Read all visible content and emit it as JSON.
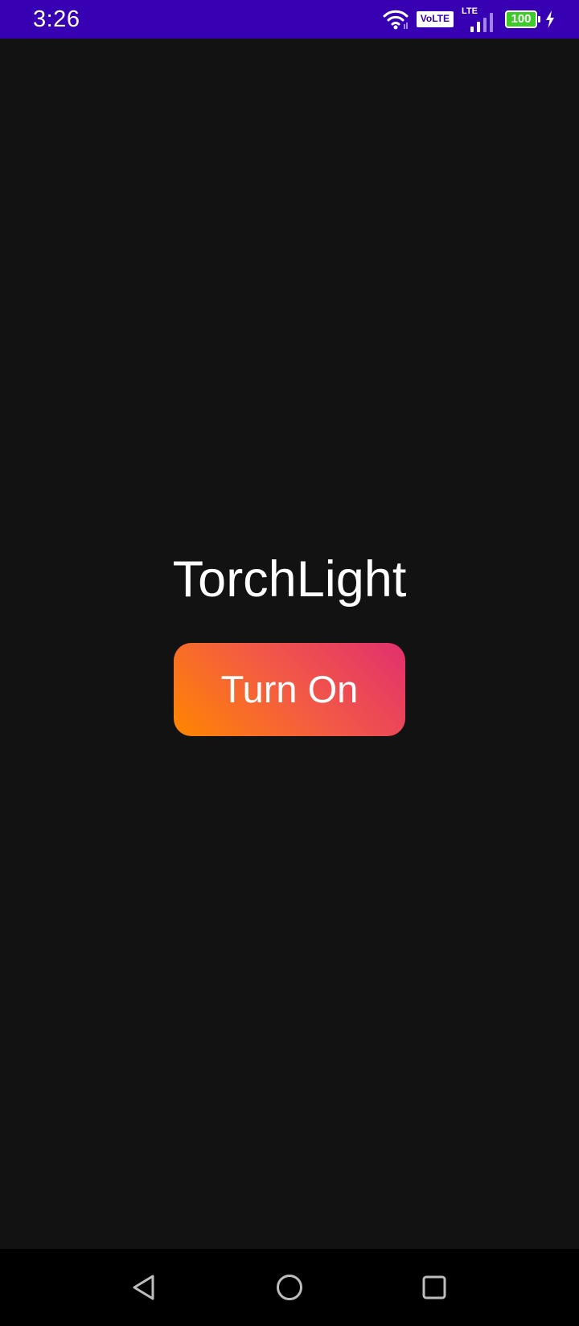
{
  "status_bar": {
    "time": "3:26",
    "volte": "VoLTE",
    "network": "LTE",
    "battery": "100",
    "icons": [
      "wifi-icon",
      "signal-icon",
      "battery-icon",
      "charging-bolt-icon"
    ],
    "background_color": "#3700b3"
  },
  "main": {
    "title": "TorchLight",
    "toggle_button_label": "Turn On",
    "background_color": "#121212",
    "button_gradient": [
      "#ff8600",
      "#e2306e"
    ]
  },
  "nav_bar": {
    "icons": [
      "back-icon",
      "home-icon",
      "recents-icon"
    ]
  }
}
